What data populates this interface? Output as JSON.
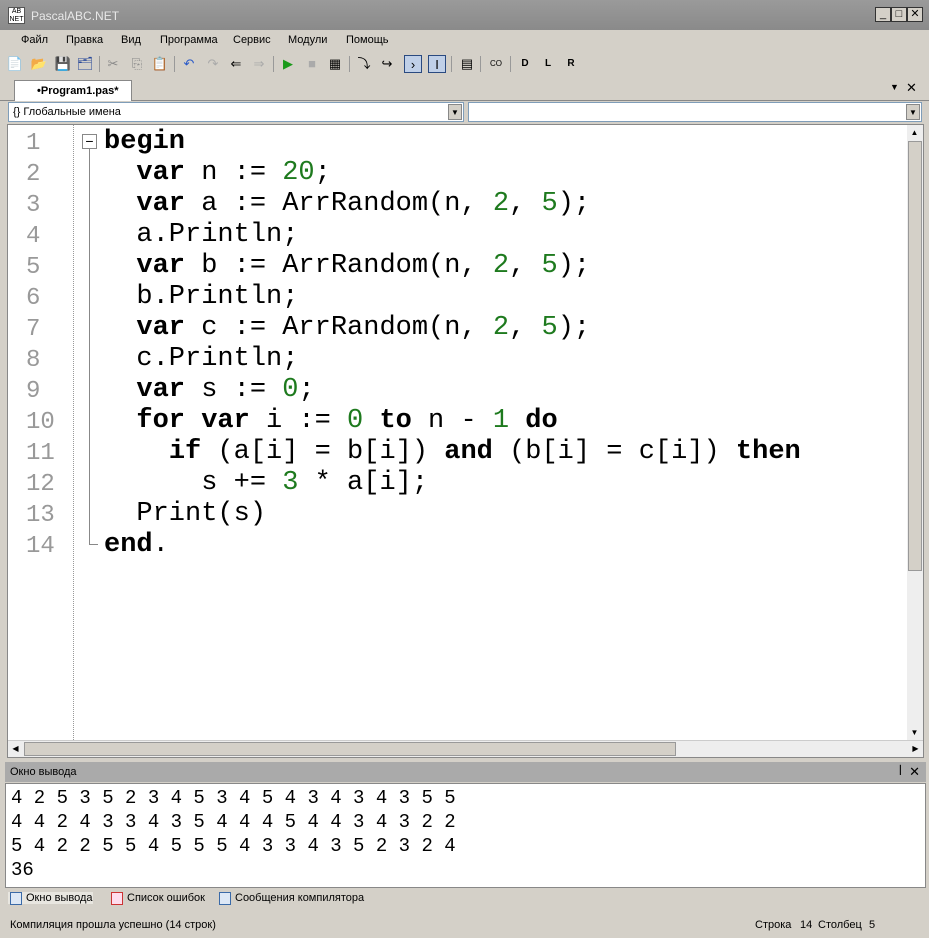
{
  "window": {
    "title": "PascalABC.NET",
    "logo": "AB NET"
  },
  "menu": [
    "Файл",
    "Правка",
    "Вид",
    "Программа",
    "Сервис",
    "Модули",
    "Помощь"
  ],
  "tab": {
    "label": "•Program1.pas*"
  },
  "combo": {
    "scope": "Глобальные имена",
    "member": ""
  },
  "lines": [
    [
      [
        "begin",
        "kw"
      ]
    ],
    [
      [
        "  "
      ],
      [
        "var",
        "kw"
      ],
      [
        " n := "
      ],
      [
        "20",
        "num"
      ],
      [
        ";"
      ]
    ],
    [
      [
        "  "
      ],
      [
        "var",
        "kw"
      ],
      [
        " a := ArrRandom(n, "
      ],
      [
        "2",
        "num"
      ],
      [
        ", "
      ],
      [
        "5",
        "num"
      ],
      [
        ");"
      ]
    ],
    [
      [
        "  a.Println;"
      ]
    ],
    [
      [
        "  "
      ],
      [
        "var",
        "kw"
      ],
      [
        " b := ArrRandom(n, "
      ],
      [
        "2",
        "num"
      ],
      [
        ", "
      ],
      [
        "5",
        "num"
      ],
      [
        ");"
      ]
    ],
    [
      [
        "  b.Println;"
      ]
    ],
    [
      [
        "  "
      ],
      [
        "var",
        "kw"
      ],
      [
        " c := ArrRandom(n, "
      ],
      [
        "2",
        "num"
      ],
      [
        ", "
      ],
      [
        "5",
        "num"
      ],
      [
        ");"
      ]
    ],
    [
      [
        "  c.Println;"
      ]
    ],
    [
      [
        "  "
      ],
      [
        "var",
        "kw"
      ],
      [
        " s := "
      ],
      [
        "0",
        "num"
      ],
      [
        ";"
      ]
    ],
    [
      [
        "  "
      ],
      [
        "for",
        "kw"
      ],
      [
        " "
      ],
      [
        "var",
        "kw"
      ],
      [
        " i := "
      ],
      [
        "0",
        "num"
      ],
      [
        " "
      ],
      [
        "to",
        "kw"
      ],
      [
        " n - "
      ],
      [
        "1",
        "num"
      ],
      [
        " "
      ],
      [
        "do",
        "kw"
      ]
    ],
    [
      [
        "    "
      ],
      [
        "if",
        "kw"
      ],
      [
        " (a[i] = b[i]) "
      ],
      [
        "and",
        "kw"
      ],
      [
        " (b[i] = c[i]) "
      ],
      [
        "then",
        "kw"
      ]
    ],
    [
      [
        "      s += "
      ],
      [
        "3",
        "num"
      ],
      [
        " * a[i];"
      ]
    ],
    [
      [
        "  Print(s)"
      ]
    ],
    [
      [
        "end",
        "kw"
      ],
      [
        "."
      ]
    ]
  ],
  "output": {
    "title": "Окно вывода",
    "lines": [
      "4 2 5 3 5 2 3 4 5 3 4 5 4 3 4 3 4 3 5 5",
      "4 4 2 4 3 3 4 3 5 4 4 4 5 4 4 3 4 3 2 2",
      "5 4 2 2 5 5 4 5 5 5 4 3 3 4 3 5 2 3 2 4",
      "36"
    ]
  },
  "bottom_tabs": [
    "Окно вывода",
    "Список ошибок",
    "Сообщения компилятора"
  ],
  "status": {
    "message": "Компиляция прошла успешно (14 строк)",
    "row_label": "Строка",
    "row": "14",
    "col_label": "Столбец",
    "col": "5"
  }
}
